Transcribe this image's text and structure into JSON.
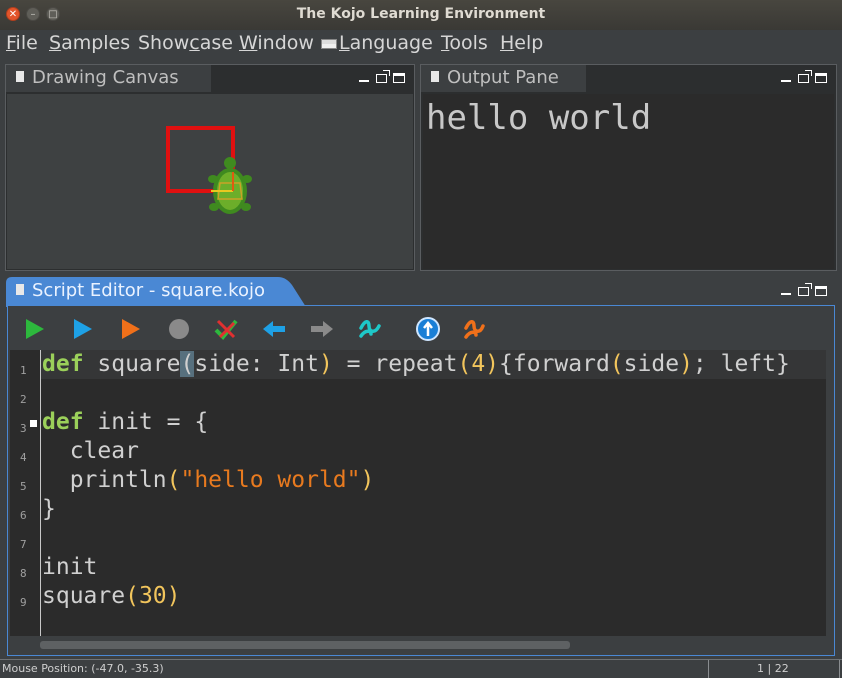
{
  "window": {
    "title": "The Kojo Learning Environment"
  },
  "menubar": {
    "items": [
      {
        "label": "File",
        "u": "F",
        "rest": "ile"
      },
      {
        "label": "Samples",
        "u": "S",
        "rest": "amples"
      },
      {
        "label": "Showcase",
        "pre": "Show",
        "u": "c",
        "rest": "ase"
      },
      {
        "label": "Window",
        "u": "W",
        "rest": "indow"
      },
      {
        "label": "Language",
        "u": "L",
        "rest": "anguage"
      },
      {
        "label": "Tools",
        "u": "T",
        "rest": "ools"
      },
      {
        "label": "Help",
        "u": "H",
        "rest": "elp"
      }
    ]
  },
  "panes": {
    "canvas_tab": "Drawing Canvas",
    "output_tab": "Output Pane",
    "editor_tab": "Script Editor - square.kojo"
  },
  "output": {
    "text": "hello world"
  },
  "toolbar": {
    "buttons": [
      "run-icon",
      "run-worksheet-icon",
      "trace-icon",
      "stop-icon",
      "check-clear-icon",
      "undo-icon",
      "redo-icon",
      "format-icon",
      "help-icon",
      "clear-output-icon"
    ]
  },
  "editor": {
    "line_numbers": [
      "1",
      "2",
      "3",
      "4",
      "5",
      "6",
      "7",
      "8",
      "9"
    ],
    "lines": [
      "def square(side: Int) = repeat(4){forward(side); left}",
      "",
      "def init = {",
      "  clear",
      "  println(\"hello world\")",
      "}",
      "",
      "init",
      "square(30)"
    ]
  },
  "status": {
    "mouse_position": "Mouse Position: (-47.0, -35.3)",
    "cursor": "1 | 22"
  },
  "colors": {
    "accent": "#4a88d4",
    "keyword": "#9bd05a",
    "number": "#f2c55c",
    "string": "#e87a1f",
    "square": "#e01010"
  }
}
